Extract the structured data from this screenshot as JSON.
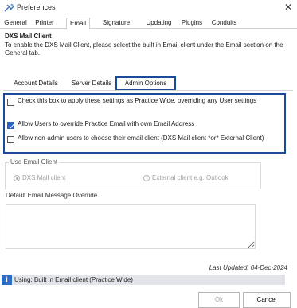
{
  "window": {
    "title": "Preferences",
    "close_glyph": "✕",
    "icon": "preferences-icon"
  },
  "tabs": [
    "General",
    "Printer",
    "Email",
    "Signature",
    "Updating",
    "Plugins",
    "Conduits"
  ],
  "active_tab": "Email",
  "section": {
    "title": "DXS Mail Client",
    "description": "To enable the DXS Mail Client, please select the built in Email client under the Email section on the General tab."
  },
  "subtabs": [
    "Account Details",
    "Server Details",
    "Admin Options"
  ],
  "active_subtab": "Admin Options",
  "admin_options": [
    {
      "label": "Check this box to apply these settings as Practice Wide, overriding any User settings",
      "checked": false
    },
    {
      "label": "Allow Users to override Practice Email with own Email Address",
      "checked": true
    },
    {
      "label": "Allow non-admin users  to choose their email client (DXS Mail client *or* External Client)",
      "checked": false
    }
  ],
  "use_email_client": {
    "title": "Use Email Client",
    "options": [
      {
        "label": "DXS Mail client",
        "selected": true
      },
      {
        "label": "External client e.g. Outlook",
        "selected": false
      }
    ]
  },
  "override": {
    "title": "Default Email Message Override",
    "value": ""
  },
  "last_updated": "Last Updated: 04-Dec-2024",
  "status": {
    "text": "Using: Built in Email client (Practice Wide)",
    "icon": "info-icon"
  },
  "buttons": {
    "ok": "Ok",
    "cancel": "Cancel"
  }
}
